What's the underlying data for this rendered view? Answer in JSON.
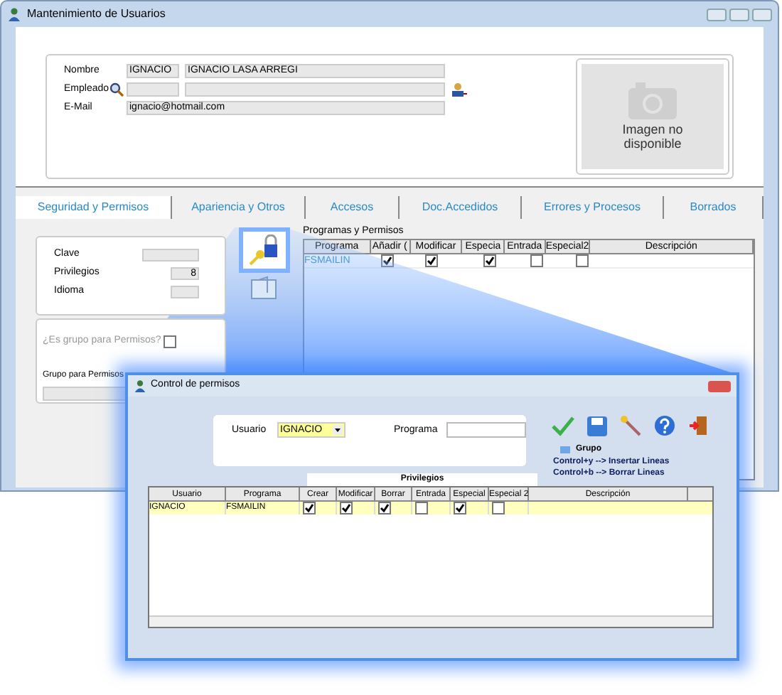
{
  "window": {
    "title": "Mantenimiento de Usuarios"
  },
  "user_form": {
    "fields": [
      {
        "label": "Nombre",
        "code": "IGNACIO",
        "name": "IGNACIO LASA ARREGI"
      },
      {
        "label": "Empleado"
      },
      {
        "label": "E-Mail",
        "value": "ignacio@hotmail.com"
      }
    ],
    "photo": {
      "caption": "Imagen no disponible"
    }
  },
  "tabs": [
    {
      "label": "Seguridad y Permisos",
      "selected": true
    },
    {
      "label": "Apariencia y Otros",
      "selected": false
    },
    {
      "label": "Accesos",
      "selected": false
    },
    {
      "label": "Doc.Accedidos",
      "selected": false
    },
    {
      "label": "Errores y Procesos",
      "selected": false
    },
    {
      "label": "Borrados",
      "selected": false
    }
  ],
  "security": {
    "fields": [
      {
        "label": "Clave"
      },
      {
        "label": "Privilegios",
        "value": "8"
      },
      {
        "label": "Idioma"
      }
    ],
    "group_check": {
      "label": "¿Es grupo para Permisos?",
      "checked": false,
      "disabled": true
    },
    "group_label": "Grupo para Permisos"
  },
  "permissions_grid": {
    "title": "Programas y Permisos",
    "columns": [
      "Programa",
      "Añadir (",
      "Modificar",
      "Especia",
      "Entrada",
      "Especial2",
      "Descripción"
    ],
    "rows": [
      {
        "program": "FSMAILIN",
        "checks": [
          true,
          true,
          true,
          false,
          false
        ]
      }
    ]
  },
  "dialog": {
    "title": "Control de permisos",
    "user_label": "Usuario",
    "user_value": "IGNACIO",
    "program_label": "Programa",
    "legend": "Grupo",
    "hints": [
      "Control+y --> Insertar Lineas",
      "Control+b --> Borrar Lineas"
    ],
    "group_header": "Privilegios",
    "columns": [
      "Usuario",
      "Programa",
      "Crear",
      "Modificar",
      "Borrar",
      "Entrada",
      "Especial",
      "Especial 2",
      "Descripción"
    ],
    "rows": [
      {
        "user": "IGNACIO",
        "program": "FSMAILIN",
        "checks": [
          true,
          true,
          true,
          false,
          true,
          false
        ],
        "selected": true
      }
    ]
  }
}
